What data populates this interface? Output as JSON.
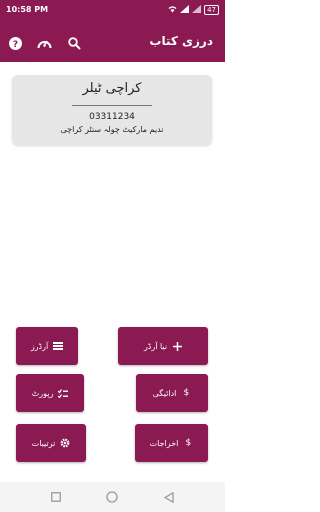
{
  "status_bar": {
    "time": "10:58 PM",
    "battery": "47"
  },
  "app_bar": {
    "title": "درزی کتاب",
    "icons": [
      "help-icon",
      "speed-icon",
      "search-icon"
    ]
  },
  "shop_card": {
    "name": "کراچی ٹیلر",
    "phone": "03311234",
    "address": "ندیم مارکیٹ چولہ سنٹر کراچی"
  },
  "menu": {
    "new_order": "نیا آرڈر",
    "orders": "آرڈرز",
    "payment": "ادائیگی",
    "report": "رپورٹ",
    "expenses": "اخراجات",
    "settings": "ترتیبات"
  },
  "nav_bar": {
    "buttons": [
      "recents",
      "home",
      "back"
    ]
  },
  "colors": {
    "primary": "#8b1a52",
    "card_bg": "#e6e6e6"
  }
}
